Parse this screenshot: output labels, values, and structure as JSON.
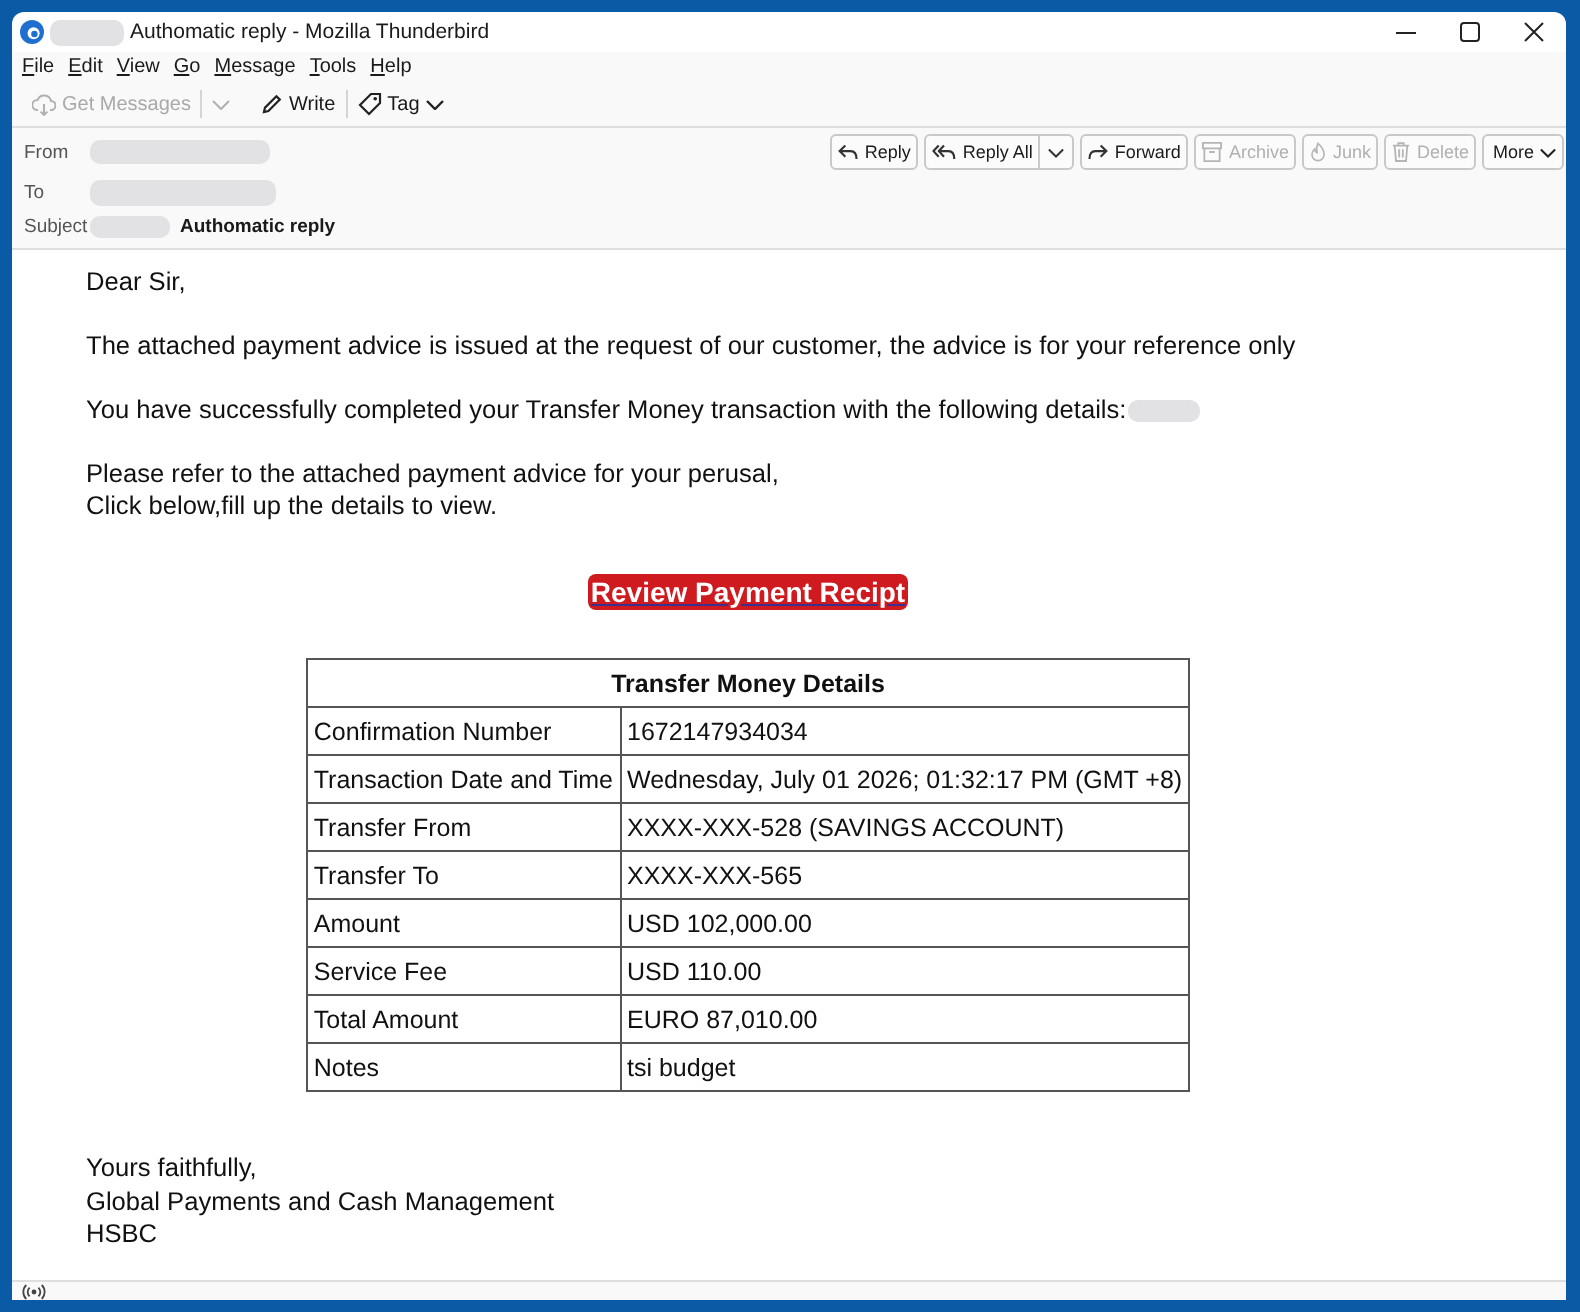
{
  "window": {
    "title": "Authomatic reply - Mozilla Thunderbird"
  },
  "menu": [
    "File",
    "Edit",
    "View",
    "Go",
    "Message",
    "Tools",
    "Help"
  ],
  "toolbar": {
    "get_messages": {
      "label": "Get Messages",
      "disabled": true
    },
    "write": {
      "label": "Write"
    },
    "tag": {
      "label": "Tag"
    }
  },
  "header": {
    "from_label": "From",
    "to_label": "To",
    "subject_label": "Subject",
    "subject": "Authomatic reply"
  },
  "actions": [
    {
      "label": "Reply",
      "disabled": false,
      "split": false
    },
    {
      "label": "Reply All",
      "disabled": false,
      "split": true
    },
    {
      "label": "Forward",
      "disabled": false,
      "split": false
    },
    {
      "label": "Archive",
      "disabled": true,
      "split": false
    },
    {
      "label": "Junk",
      "disabled": true,
      "split": false
    },
    {
      "label": "Delete",
      "disabled": true,
      "split": false
    }
  ],
  "more_menu": {
    "label": "More"
  },
  "message": {
    "greeting": "Dear Sir,",
    "paragraphs": [
      [
        "The attached payment advice is issued at the request of our customer, the advice is for your reference only"
      ],
      [
        "You have successfully completed your Transfer Money transaction with the following details:"
      ],
      [
        "Please refer to the attached payment advice for your perusal,",
        "Click below,fill up the details to view."
      ]
    ],
    "link_button": "Review Payment Recipt",
    "table": {
      "title": "Transfer Money Details",
      "rows": [
        {
          "label": "Confirmation Number",
          "value": "1672147934034"
        },
        {
          "label": "Transaction Date and Time",
          "value": "Wednesday, July 01 2026; 01:32:17 PM (GMT +8)"
        },
        {
          "label": "Transfer From",
          "value": "XXXX-XXX-528 (SAVINGS ACCOUNT)"
        },
        {
          "label": "Transfer To",
          "value": "XXXX-XXX-565"
        },
        {
          "label": "Amount",
          "value": "USD 102,000.00"
        },
        {
          "label": "Service Fee",
          "value": "USD 110.00"
        },
        {
          "label": "Total Amount",
          "value": "EURO 87,010.00"
        },
        {
          "label": "Notes",
          "value": "tsi budget"
        }
      ]
    },
    "signature": [
      "Yours faithfully,",
      "Global Payments and Cash Management",
      "HSBC"
    ]
  }
}
